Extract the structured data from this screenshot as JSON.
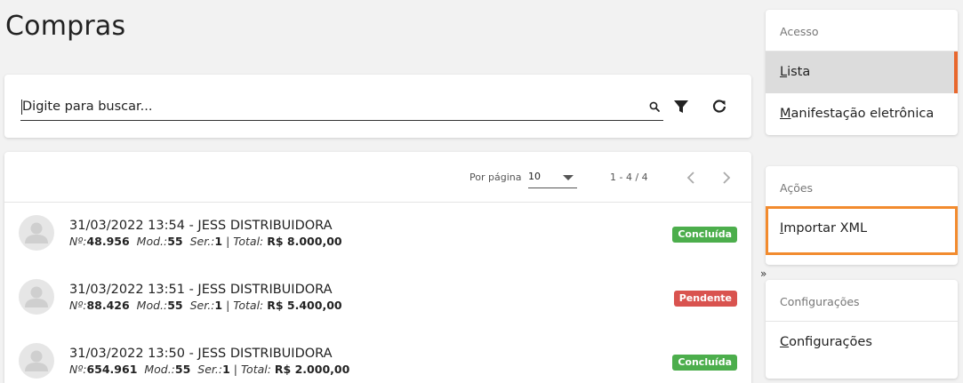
{
  "page": {
    "title": "Compras"
  },
  "search": {
    "placeholder": "Digite para buscar..."
  },
  "pagination": {
    "per_page_label": "Por página",
    "per_page_value": "10",
    "range": "1 - 4 / 4"
  },
  "purchases": [
    {
      "title": "31/03/2022 13:54 - JESS DISTRIBUIDORA",
      "no_label": "Nº:",
      "no": "48.956",
      "mod_label": "Mod.:",
      "mod": "55",
      "ser_label": "Ser.:",
      "ser": "1",
      "total_label": "Total:",
      "total": "R$ 8.000,00",
      "status": "Concluída",
      "status_color": "#4cae4c"
    },
    {
      "title": "31/03/2022 13:51 - JESS DISTRIBUIDORA",
      "no_label": "Nº:",
      "no": "88.426",
      "mod_label": "Mod.:",
      "mod": "55",
      "ser_label": "Ser.:",
      "ser": "1",
      "total_label": "Total:",
      "total": "R$ 5.400,00",
      "status": "Pendente",
      "status_color": "#d9534f"
    },
    {
      "title": "31/03/2022 13:50 - JESS DISTRIBUIDORA",
      "no_label": "Nº:",
      "no": "654.961",
      "mod_label": "Mod.:",
      "mod": "55",
      "ser_label": "Ser.:",
      "ser": "1",
      "total_label": "Total:",
      "total": "R$ 2.000,00",
      "status": "Concluída",
      "status_color": "#4cae4c"
    }
  ],
  "sidebar": {
    "access": {
      "heading": "Acesso",
      "items": [
        {
          "first": "L",
          "rest": "ista"
        },
        {
          "first": "M",
          "rest": "anifestação eletrônica"
        }
      ]
    },
    "actions": {
      "heading": "Ações",
      "items": [
        {
          "first": "I",
          "rest": "mportar XML"
        }
      ]
    },
    "settings": {
      "heading": "Configurações",
      "items": [
        {
          "first": "C",
          "rest": "onfigurações"
        }
      ]
    },
    "collapse_glyph": "»"
  },
  "colors": {
    "accent": "#e8672d",
    "highlight": "#f28b2e",
    "success": "#4cae4c",
    "danger": "#d9534f"
  },
  "icons": [
    "search-icon",
    "filter-icon",
    "refresh-icon",
    "chevron-left-icon",
    "chevron-right-icon",
    "person-icon"
  ]
}
